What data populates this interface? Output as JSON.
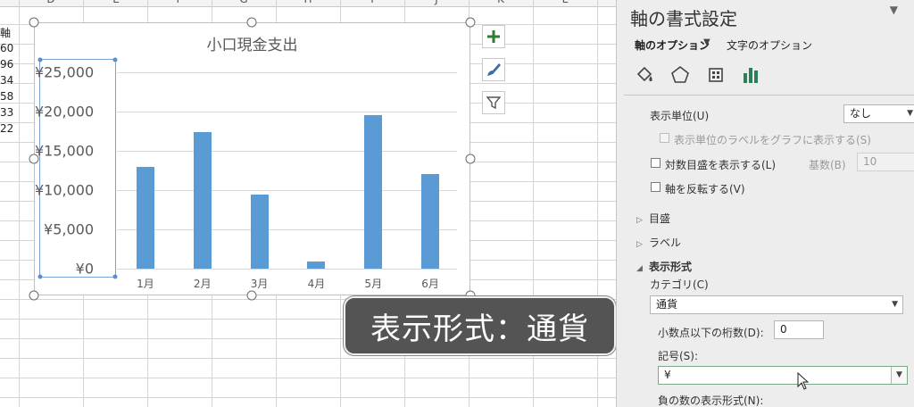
{
  "sheet": {
    "columns": [
      "D",
      "E",
      "F",
      "G",
      "H",
      "I",
      "J",
      "K",
      "L"
    ],
    "cell_fragments": [
      "軸",
      "60",
      "96",
      "34",
      "58",
      "33",
      "22"
    ]
  },
  "chart_data": {
    "type": "bar",
    "title": "小口現金支出",
    "categories": [
      "1月",
      "2月",
      "3月",
      "4月",
      "5月",
      "6月"
    ],
    "values": [
      12900,
      17400,
      9400,
      900,
      19500,
      12100
    ],
    "yticks": [
      "¥0",
      "¥5,000",
      "¥10,000",
      "¥15,000",
      "¥20,000",
      "¥25,000"
    ],
    "ylim": [
      0,
      25000
    ],
    "grid": true,
    "color": "#5b9bd5"
  },
  "chart_buttons": {
    "add": "chart-elements-plus-icon",
    "style": "chart-style-brush-icon",
    "filter": "chart-filter-funnel-icon"
  },
  "caption": "表示形式：通貨",
  "pane": {
    "title": "軸の書式設定",
    "tabs": {
      "axis_options": "軸のオプション",
      "text_options": "文字のオプション"
    },
    "icons": [
      "fill-line-icon",
      "effects-pentagon-icon",
      "size-properties-icon",
      "axis-options-bars-icon"
    ],
    "display_units_label": "表示単位(U)",
    "display_units_value": "なし",
    "show_units_label": "表示単位のラベルをグラフに表示する(S)",
    "log_scale_label": "対数目盛を表示する(L)",
    "base_label": "基数(B)",
    "base_value": "10",
    "reverse_label": "軸を反転する(V)",
    "sections": {
      "ticks": "目盛",
      "labels": "ラベル",
      "number": "表示形式"
    },
    "category_label": "カテゴリ(C)",
    "category_value": "通貨",
    "decimals_label": "小数点以下の桁数(D):",
    "decimals_value": "0",
    "symbol_label": "記号(S):",
    "symbol_value": "¥",
    "negative_label": "負の数の表示形式(N):"
  }
}
